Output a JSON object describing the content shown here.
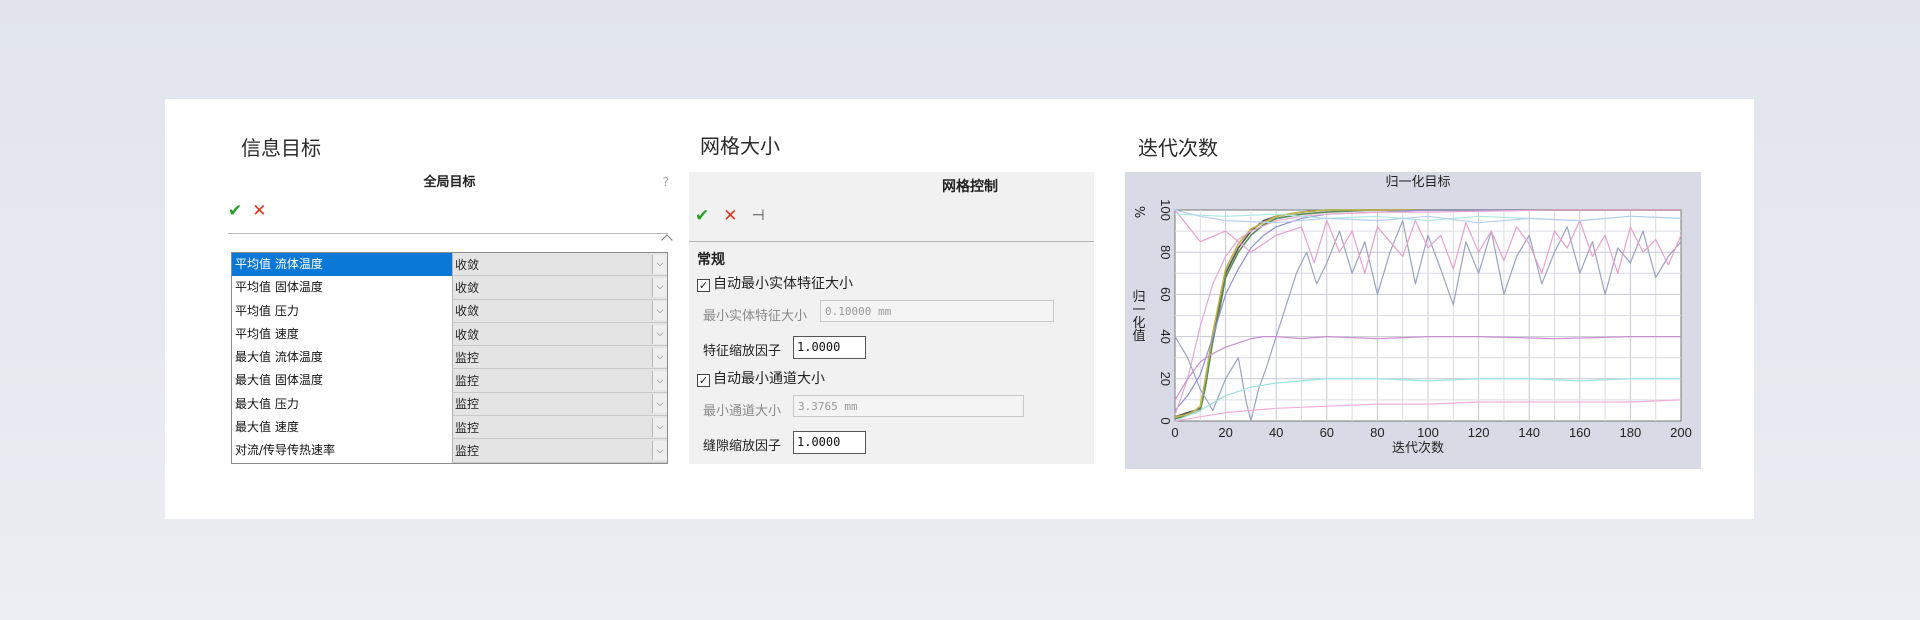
{
  "sections": {
    "goals_title": "信息目标",
    "mesh_title": "网格大小",
    "iter_title": "迭代次数"
  },
  "goals_panel": {
    "title": "全局目标",
    "help": "?",
    "ok_icon": "check-icon",
    "cancel_icon": "close-icon",
    "rows": [
      {
        "name": "平均值 流体温度",
        "value": "收敛",
        "selected": true
      },
      {
        "name": "平均值 固体温度",
        "value": "收敛"
      },
      {
        "name": "平均值 压力",
        "value": "收敛"
      },
      {
        "name": "平均值 速度",
        "value": "收敛"
      },
      {
        "name": "最大值 流体温度",
        "value": "监控"
      },
      {
        "name": "最大值 固体温度",
        "value": "监控"
      },
      {
        "name": "最大值 压力",
        "value": "监控"
      },
      {
        "name": "最大值 速度",
        "value": "监控"
      },
      {
        "name": "对流/传导传热速率",
        "value": "监控"
      }
    ]
  },
  "mesh_panel": {
    "title": "网格控制",
    "section": "常规",
    "auto_min_feature": {
      "label": "自动最小实体特征大小",
      "checked": true
    },
    "min_feature_size": {
      "label": "最小实体特征大小",
      "value": "0.10000 mm"
    },
    "feature_scale": {
      "label": "特征缩放因子",
      "value": "1.0000"
    },
    "auto_min_channel": {
      "label": "自动最小通道大小",
      "checked": true
    },
    "min_channel_size": {
      "label": "最小通道大小",
      "value": "3.3765 mm"
    },
    "gap_scale": {
      "label": "缝隙缩放因子",
      "value": "1.0000"
    }
  },
  "chart_data": {
    "type": "line",
    "title": "归一化目标",
    "xlabel": "迭代次数",
    "ylabel": "归一化值",
    "y_unit": "%",
    "xlim": [
      0,
      200
    ],
    "ylim": [
      0,
      100
    ],
    "xticks": [
      0,
      20,
      40,
      60,
      80,
      100,
      120,
      140,
      160,
      180,
      200
    ],
    "yticks": [
      0,
      20,
      40,
      60,
      80,
      100
    ],
    "grid": true,
    "series": [
      {
        "color": "#555555",
        "x": [
          0,
          5,
          8,
          10,
          12,
          15,
          18,
          20,
          25,
          30,
          35,
          40,
          45,
          50,
          60,
          80,
          100,
          150,
          200
        ],
        "y": [
          2,
          4,
          5,
          6,
          18,
          40,
          58,
          70,
          82,
          90,
          95,
          97,
          98,
          99,
          100,
          100,
          100,
          100,
          100
        ]
      },
      {
        "color": "#5a8a5a",
        "x": [
          0,
          5,
          8,
          10,
          12,
          15,
          18,
          20,
          25,
          30,
          35,
          40,
          50,
          60,
          80,
          100,
          150,
          200
        ],
        "y": [
          1,
          3,
          4,
          5,
          16,
          38,
          55,
          68,
          80,
          88,
          93,
          96,
          98,
          99,
          100,
          100,
          100,
          100
        ]
      },
      {
        "color": "#c2b34a",
        "x": [
          0,
          5,
          8,
          10,
          12,
          15,
          18,
          20,
          25,
          30,
          40,
          50,
          60,
          80,
          100,
          150,
          200
        ],
        "y": [
          2,
          3,
          5,
          7,
          20,
          42,
          60,
          72,
          84,
          91,
          97,
          99,
          100,
          100,
          100,
          100,
          100
        ]
      },
      {
        "color": "#8f8fd8",
        "x": [
          0,
          5,
          10,
          15,
          20,
          25,
          30,
          35,
          40,
          50,
          60,
          80,
          100,
          150,
          200
        ],
        "y": [
          5,
          12,
          22,
          40,
          60,
          72,
          82,
          88,
          92,
          96,
          98,
          99,
          100,
          100,
          100
        ]
      },
      {
        "color": "#e7a7d3",
        "x": [
          0,
          5,
          10,
          15,
          20,
          25,
          30,
          40,
          50,
          60,
          80,
          100,
          150,
          200
        ],
        "y": [
          3,
          20,
          45,
          65,
          78,
          86,
          90,
          95,
          97,
          98,
          99,
          99,
          100,
          100
        ]
      },
      {
        "color": "#c98fd0",
        "x": [
          0,
          5,
          10,
          15,
          20,
          25,
          30,
          35,
          40,
          50,
          60,
          80,
          100,
          120,
          150,
          180,
          200
        ],
        "y": [
          10,
          20,
          28,
          32,
          35,
          37,
          39,
          40,
          40,
          39,
          40,
          39,
          40,
          40,
          39,
          40,
          40
        ]
      },
      {
        "color": "#9aa2c2",
        "x": [
          0,
          5,
          10,
          15,
          20,
          25,
          28,
          30,
          33,
          36,
          40,
          44,
          48,
          52,
          56,
          60,
          65,
          70,
          75,
          80,
          85,
          90,
          95,
          100,
          105,
          110,
          115,
          120,
          125,
          130,
          135,
          140,
          145,
          150,
          155,
          160,
          165,
          170,
          175,
          180,
          185,
          190,
          195,
          200
        ],
        "y": [
          40,
          30,
          15,
          5,
          20,
          30,
          10,
          0,
          15,
          25,
          40,
          55,
          70,
          80,
          65,
          75,
          90,
          70,
          85,
          60,
          80,
          95,
          65,
          88,
          72,
          55,
          85,
          70,
          90,
          60,
          78,
          88,
          65,
          80,
          92,
          70,
          85,
          60,
          82,
          75,
          90,
          68,
          78,
          85
        ]
      },
      {
        "color": "#eaa0cf",
        "x": [
          0,
          10,
          20,
          30,
          40,
          50,
          55,
          60,
          65,
          70,
          75,
          80,
          85,
          90,
          95,
          100,
          105,
          110,
          115,
          120,
          125,
          130,
          135,
          140,
          145,
          150,
          155,
          160,
          165,
          170,
          175,
          180,
          185,
          190,
          195,
          200
        ],
        "y": [
          100,
          85,
          90,
          80,
          88,
          92,
          75,
          95,
          80,
          90,
          70,
          92,
          85,
          78,
          95,
          82,
          88,
          72,
          94,
          80,
          90,
          76,
          92,
          84,
          70,
          90,
          82,
          95,
          78,
          88,
          70,
          92,
          80,
          86,
          74,
          88
        ]
      },
      {
        "color": "#9be3db",
        "x": [
          0,
          10,
          20,
          30,
          40,
          50,
          60,
          80,
          100,
          120,
          140,
          160,
          180,
          200
        ],
        "y": [
          0,
          5,
          12,
          16,
          18,
          19,
          20,
          20,
          19,
          20,
          20,
          19,
          20,
          20
        ]
      },
      {
        "color": "#f0b0d8",
        "x": [
          0,
          10,
          20,
          30,
          40,
          60,
          80,
          100,
          120,
          140,
          160,
          180,
          200
        ],
        "y": [
          0,
          2,
          4,
          5,
          6,
          7,
          8,
          8,
          9,
          9,
          9,
          9,
          10
        ]
      },
      {
        "color": "#aee8e2",
        "x": [
          0,
          20,
          40,
          60,
          80,
          100,
          120,
          140,
          160,
          180,
          200
        ],
        "y": [
          98,
          97,
          98,
          96,
          97,
          95,
          97,
          96,
          95,
          97,
          96
        ]
      },
      {
        "color": "#b9d0ee",
        "x": [
          0,
          10,
          20,
          40,
          60,
          80,
          100,
          120,
          140,
          160,
          180,
          200
        ],
        "y": [
          100,
          97,
          95,
          94,
          96,
          95,
          97,
          94,
          96,
          95,
          97,
          96
        ]
      }
    ]
  }
}
